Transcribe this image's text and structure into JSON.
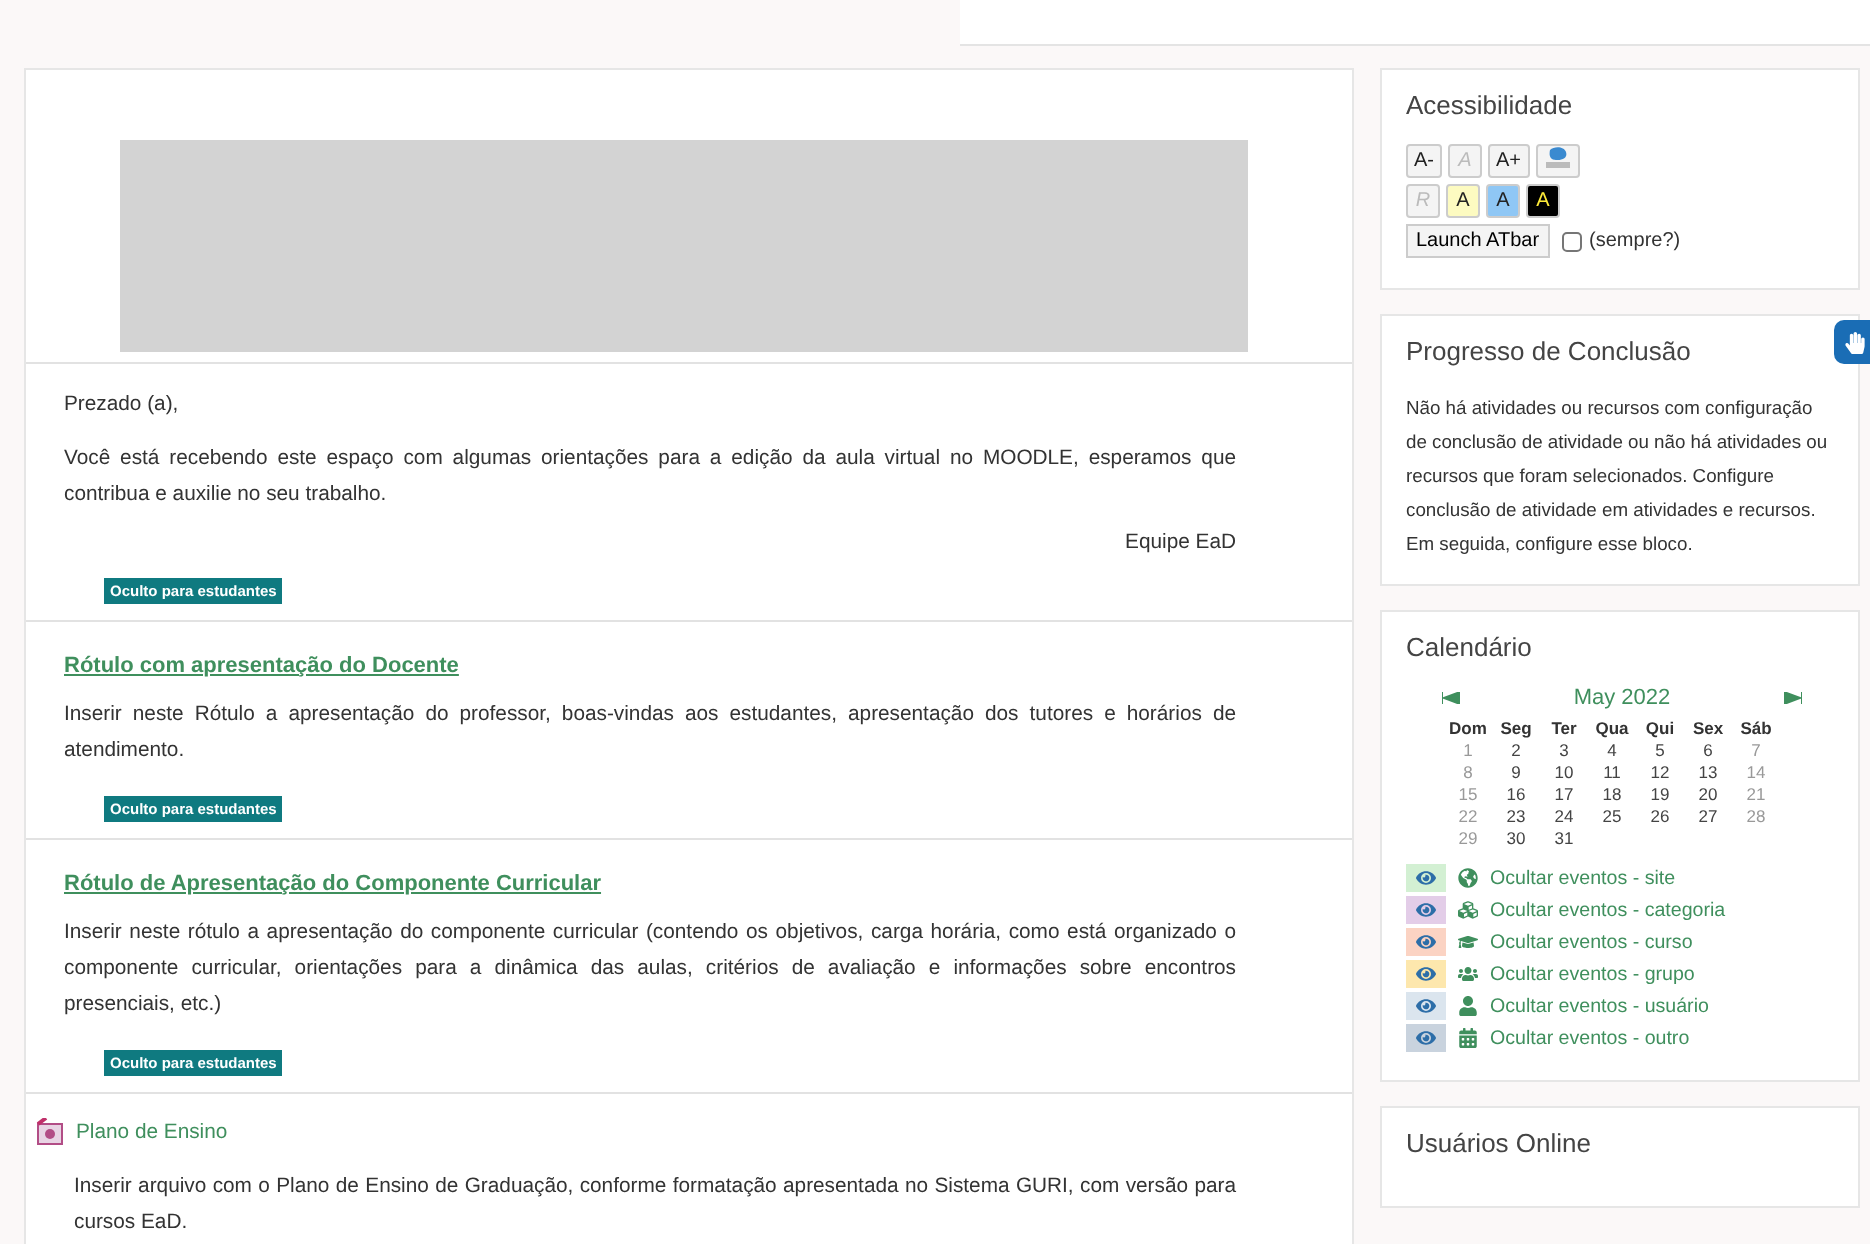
{
  "main": {
    "intro": {
      "greeting": "Prezado (a),",
      "body": "Você está recebendo este espaço com algumas orientações para a edição da aula virtual no MOODLE, esperamos que contribua e auxilie no seu trabalho.",
      "signature": "Equipe EaD",
      "badge": "Oculto para estudantes"
    },
    "items": [
      {
        "kind": "label",
        "title": "Rótulo com apresentação do Docente",
        "body": "Inserir neste Rótulo a apresentação do professor, boas-vindas aos estudantes, apresentação dos tutores e horários de atendimento.",
        "badge": "Oculto para estudantes"
      },
      {
        "kind": "label",
        "title": "Rótulo de Apresentação do Componente Curricular",
        "body": "Inserir neste rótulo a apresentação do componente curricular (contendo os objetivos, carga horária, como está organizado o componente curricular, orientações para a dinâmica das aulas, critérios de avaliação e informações sobre encontros presenciais, etc.)",
        "badge": "Oculto para estudantes"
      },
      {
        "kind": "file",
        "title": "Plano de Ensino",
        "body": "Inserir arquivo com o Plano de Ensino de Graduação, conforme formatação apresentada no Sistema GURI, com versão para cursos EaD."
      }
    ]
  },
  "sidebar": {
    "accessibility": {
      "title": "Acessibilidade",
      "row1": [
        {
          "kind": "plain",
          "label": "A-",
          "disabled": false
        },
        {
          "kind": "plain",
          "label": "A",
          "disabled": true
        },
        {
          "kind": "plain",
          "label": "A+",
          "disabled": false
        },
        {
          "kind": "icon"
        }
      ],
      "row2": [
        {
          "kind": "plain",
          "label": "R",
          "disabled": true
        },
        {
          "kind": "yellow",
          "label": "A",
          "disabled": false
        },
        {
          "kind": "blue",
          "label": "A",
          "disabled": false
        },
        {
          "kind": "black",
          "label": "A",
          "disabled": false
        }
      ],
      "launch": "Launch ATbar",
      "always": {
        "label": "(sempre?)",
        "checked": false
      }
    },
    "progress": {
      "title": "Progresso de Conclusão",
      "text": "Não há atividades ou recursos com configuração de conclusão de atividade ou não há atividades ou recursos que foram selecionados. Configure conclusão de atividade em atividades e recursos. Em seguida, configure esse bloco."
    },
    "calendar": {
      "title": "Calendário",
      "month": "May 2022",
      "weekdays": [
        "Dom",
        "Seg",
        "Ter",
        "Qua",
        "Qui",
        "Sex",
        "Sáb"
      ],
      "weeks": [
        [
          "1",
          "2",
          "3",
          "4",
          "5",
          "6",
          "7"
        ],
        [
          "8",
          "9",
          "10",
          "11",
          "12",
          "13",
          "14"
        ],
        [
          "15",
          "16",
          "17",
          "18",
          "19",
          "20",
          "21"
        ],
        [
          "22",
          "23",
          "24",
          "25",
          "26",
          "27",
          "28"
        ],
        [
          "29",
          "30",
          "31"
        ]
      ],
      "filters": [
        {
          "kind": "globe",
          "label": "Ocultar eventos - site",
          "color": "#d3f0d3"
        },
        {
          "kind": "cubes",
          "label": "Ocultar eventos - categoria",
          "color": "#e3cde8"
        },
        {
          "kind": "cap",
          "label": "Ocultar eventos - curso",
          "color": "#fbd3c3"
        },
        {
          "kind": "users",
          "label": "Ocultar eventos - grupo",
          "color": "#fde7ad"
        },
        {
          "kind": "user",
          "label": "Ocultar eventos - usuário",
          "color": "#dbe5ee"
        },
        {
          "kind": "calendar",
          "label": "Ocultar eventos - outro",
          "color": "#c9d3de"
        }
      ]
    },
    "online": {
      "title": "Usuários Online"
    }
  }
}
